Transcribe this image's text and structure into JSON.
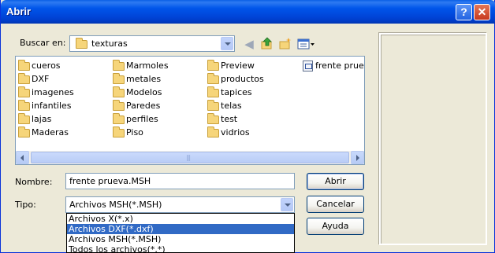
{
  "window": {
    "title": "Abrir"
  },
  "titlebar": {
    "help": "?",
    "close": "✕"
  },
  "lookin": {
    "label": "Buscar en:",
    "value": "texturas"
  },
  "files": {
    "col1": [
      "cueros",
      "DXF",
      "imagenes",
      "infantiles",
      "lajas",
      "Maderas"
    ],
    "col2": [
      "Marmoles",
      "metales",
      "Modelos",
      "Paredes",
      "perfiles",
      "Piso"
    ],
    "col3": [
      "Preview",
      "productos",
      "tapices",
      "telas",
      "test",
      "vidrios"
    ],
    "col4": [
      "frente pruev"
    ]
  },
  "name": {
    "label": "Nombre:",
    "value": "frente prueva.MSH"
  },
  "type": {
    "label": "Tipo:",
    "value": "Archivos MSH(*.MSH)",
    "options": [
      "Archivos X(*.x)",
      "Archivos DXF(*.dxf)",
      "Archivos MSH(*.MSH)",
      "Todos los archivos(*.*)"
    ]
  },
  "buttons": {
    "open": "Abrir",
    "cancel": "Cancelar",
    "help": "Ayuda"
  }
}
